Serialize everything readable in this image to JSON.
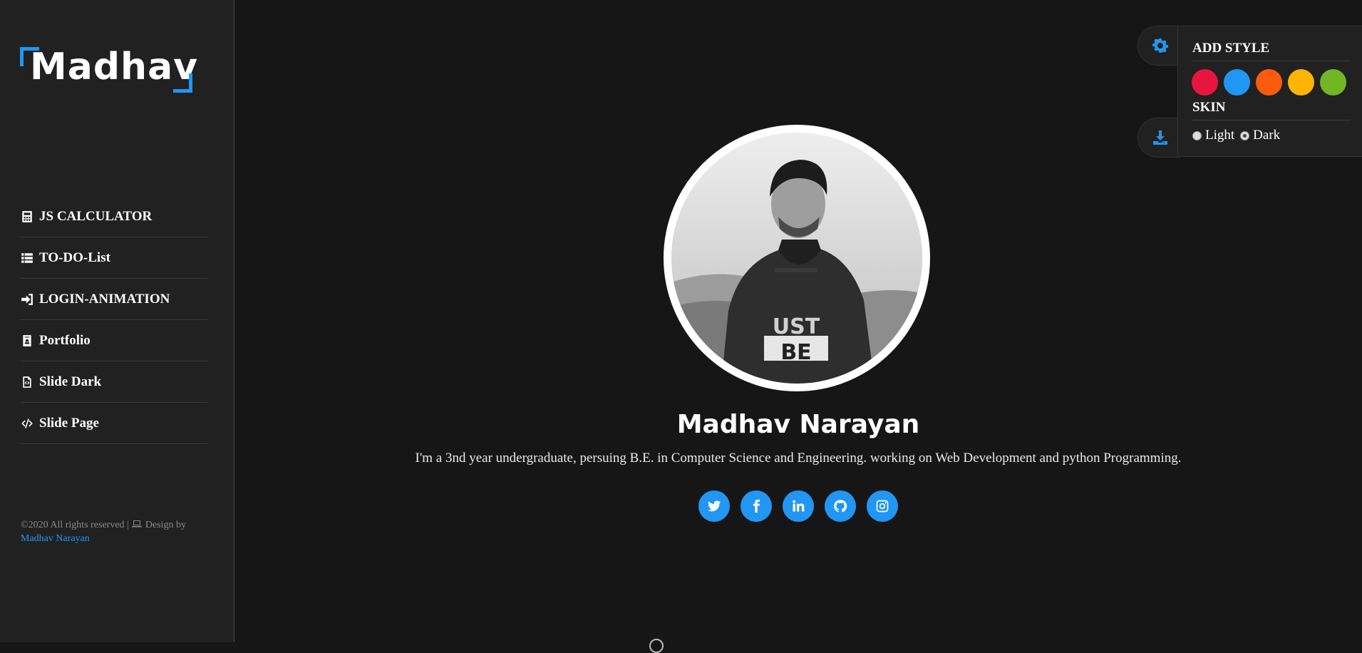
{
  "brand": {
    "logo_text": "Madhav",
    "accent_color": "#2196f3"
  },
  "sidebar": {
    "items": [
      {
        "label": "JS CALCULATOR",
        "icon": "calculator-icon"
      },
      {
        "label": "TO-DO-List",
        "icon": "list-icon"
      },
      {
        "label": "LOGIN-ANIMATION",
        "icon": "sign-in-icon"
      },
      {
        "label": "Portfolio",
        "icon": "id-badge-icon"
      },
      {
        "label": "Slide Dark",
        "icon": "file-code-icon"
      },
      {
        "label": "Slide Page",
        "icon": "code-icon"
      }
    ],
    "footer": {
      "text_before": "©2020 All rights reserved | ",
      "design_text": " Design by ",
      "author_link": "Madhav Narayan"
    }
  },
  "profile": {
    "name": "Madhav Narayan",
    "bio": "I'm a 3nd year undergraduate, persuing B.E. in Computer Science and Engineering. working on Web Development and python Programming.",
    "socials": [
      {
        "name": "twitter",
        "icon": "twitter-icon"
      },
      {
        "name": "facebook",
        "icon": "facebook-icon"
      },
      {
        "name": "linkedin",
        "icon": "linkedin-icon"
      },
      {
        "name": "github",
        "icon": "github-icon"
      },
      {
        "name": "instagram",
        "icon": "instagram-icon"
      }
    ]
  },
  "style_switcher": {
    "heading": "ADD STYLE",
    "colors": [
      "#e8163e",
      "#2196f3",
      "#fa5b0f",
      "#ffb400",
      "#72b626"
    ],
    "skin_heading": "SKIN",
    "skin_options": [
      "Light",
      "Dark"
    ],
    "selected_skin": "Dark",
    "toggle_icon": "gear-icon",
    "download_icon": "download-icon"
  }
}
